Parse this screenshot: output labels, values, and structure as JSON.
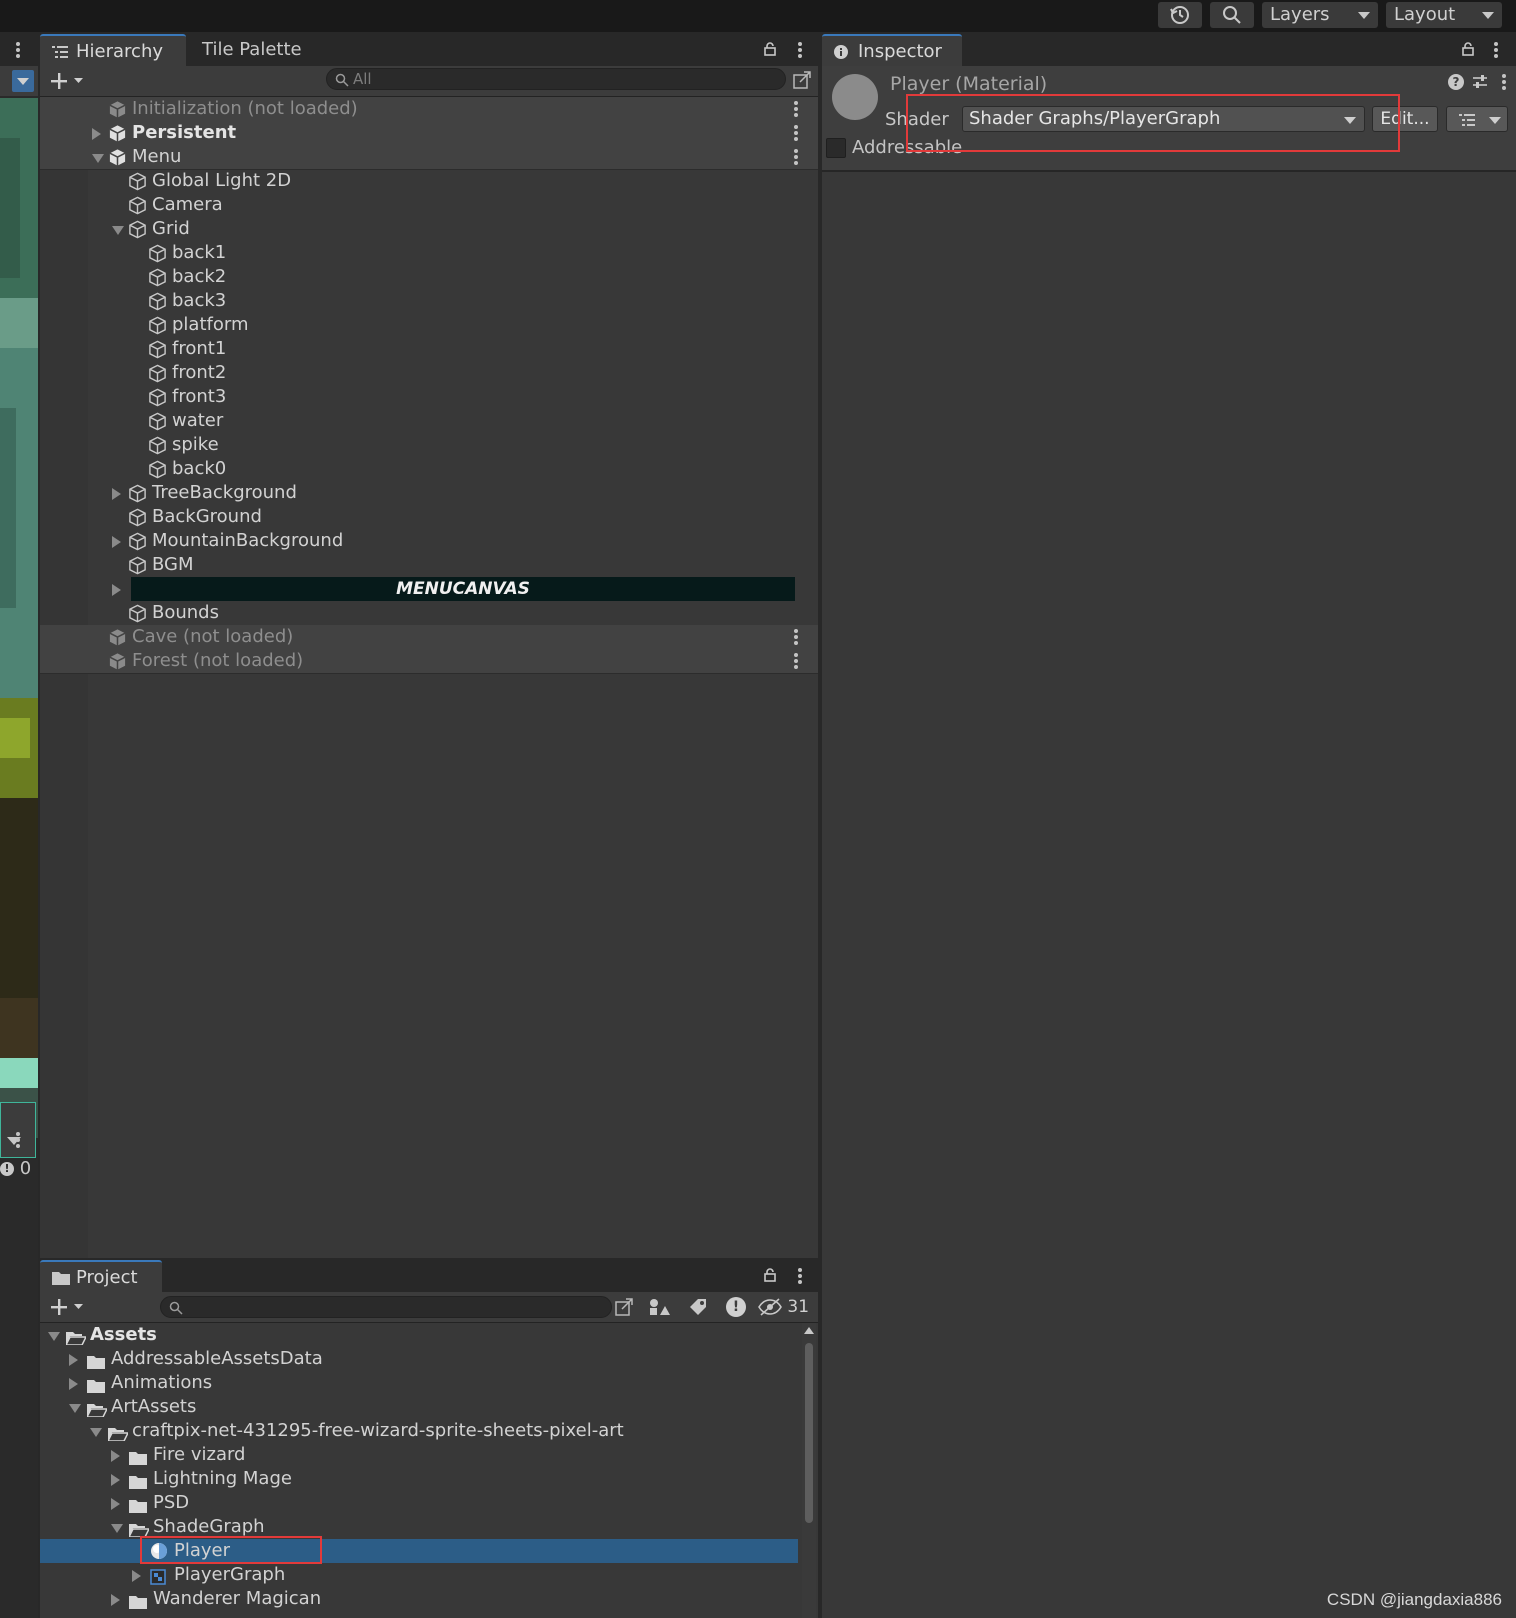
{
  "toolbar": {
    "layers_label": "Layers",
    "layout_label": "Layout"
  },
  "hierarchy": {
    "tab_label": "Hierarchy",
    "tab2_label": "Tile Palette",
    "search_placeholder": "All",
    "rows": [
      {
        "label": "Initialization (not loaded)",
        "type": "scene-unloaded"
      },
      {
        "label": "Persistent",
        "type": "scene"
      },
      {
        "label": "Menu",
        "type": "scene"
      },
      {
        "label": "Global Light 2D"
      },
      {
        "label": "Camera"
      },
      {
        "label": "Grid"
      },
      {
        "label": "back1"
      },
      {
        "label": "back2"
      },
      {
        "label": "back3"
      },
      {
        "label": "platform"
      },
      {
        "label": "front1"
      },
      {
        "label": "front2"
      },
      {
        "label": "front3"
      },
      {
        "label": "water"
      },
      {
        "label": "spike"
      },
      {
        "label": "back0"
      },
      {
        "label": "TreeBackground"
      },
      {
        "label": "BackGround"
      },
      {
        "label": "MountainBackground"
      },
      {
        "label": "BGM"
      },
      {
        "label": "MENUCANVAS"
      },
      {
        "label": "Bounds"
      },
      {
        "label": "Cave (not loaded)",
        "type": "scene-unloaded"
      },
      {
        "label": "Forest (not loaded)",
        "type": "scene-unloaded"
      }
    ]
  },
  "inspector": {
    "tab_label": "Inspector",
    "material_title": "Player (Material)",
    "shader_label": "Shader",
    "shader_value": "Shader Graphs/PlayerGraph",
    "edit_label": "Edit...",
    "addressable_label": "Addressable"
  },
  "project": {
    "tab_label": "Project",
    "hidden_count": "31",
    "rows": [
      {
        "label": "Assets"
      },
      {
        "label": "AddressableAssetsData"
      },
      {
        "label": "Animations"
      },
      {
        "label": "ArtAssets"
      },
      {
        "label": "craftpix-net-431295-free-wizard-sprite-sheets-pixel-art"
      },
      {
        "label": "Fire vizard"
      },
      {
        "label": "Lightning Mage"
      },
      {
        "label": "PSD"
      },
      {
        "label": "ShadeGraph"
      },
      {
        "label": "Player"
      },
      {
        "label": "PlayerGraph"
      },
      {
        "label": "Wanderer Magican"
      }
    ]
  },
  "left_panel": {
    "count_label": "0"
  },
  "watermark": "CSDN @jiangdaxia886",
  "colors": {
    "accent_blue": "#3a79bb",
    "selection": "#2c5d87",
    "highlight_red": "#e23a3a",
    "panel_bg": "#383838"
  }
}
